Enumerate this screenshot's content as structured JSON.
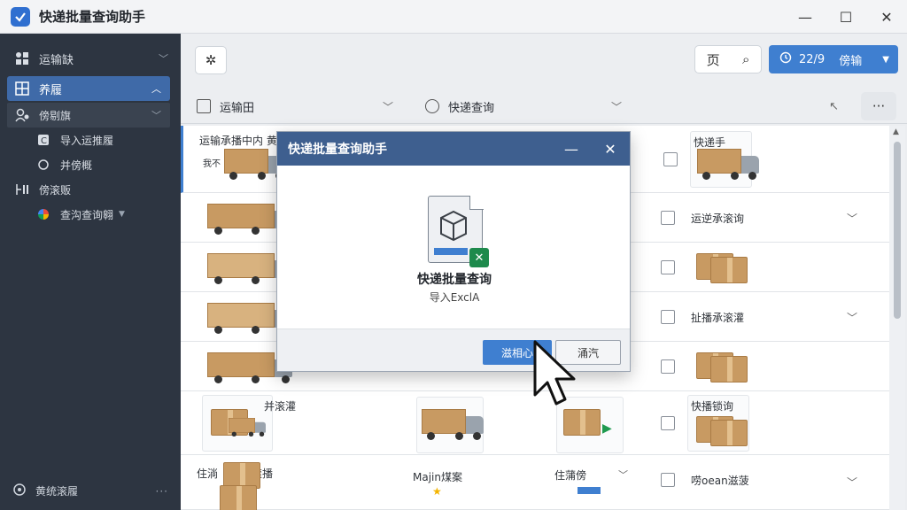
{
  "window": {
    "title": "快递批量查询助手",
    "minimize": "—",
    "maximize": "☐",
    "close": "✕"
  },
  "sidebar": {
    "items": [
      {
        "label": "运输缺",
        "icon": "grid-icon"
      },
      {
        "label": "养履",
        "icon": "list-icon"
      },
      {
        "label": "傍剔旗",
        "icon": "user-icon"
      },
      {
        "label": "导入运推履",
        "icon": "import-icon"
      },
      {
        "label": "并傍概",
        "icon": "circle-icon"
      },
      {
        "label": "傍滚贩",
        "icon": "columns-icon"
      },
      {
        "label": "查沟查询翱",
        "icon": "chart-icon"
      }
    ],
    "bottom_label": "黄统滚履",
    "bottom_more": "···"
  },
  "toolbar": {
    "tool_icon": "✲",
    "page_label": "页",
    "search_glyph": "⌕",
    "primary_label": "22/9",
    "primary_text": "傍输",
    "more_dots": "···",
    "back_glyph": "↖"
  },
  "filters": [
    {
      "label": "运输田"
    },
    {
      "label": "快递查询"
    }
  ],
  "rows": [
    {
      "text_a": "运输承播中内 黄",
      "text_a2": "我不",
      "text_c": "快递手",
      "has_chev": false
    },
    {
      "text_a": "",
      "text_c": "运逆承滚询",
      "has_chev": true
    },
    {
      "text_a": "",
      "text_c": "",
      "has_chev": false
    },
    {
      "text_a": "",
      "text_c": "扯播承滚灌",
      "has_chev": true
    },
    {
      "text_a": "",
      "text_c": "",
      "has_chev": false
    },
    {
      "text_a": "并滚灌",
      "text_c": "快播锁询",
      "has_chev": false
    },
    {
      "text_a": "住淌",
      "text_a2": "滚播",
      "text_b": "Majin煤案",
      "text_b2": "住蒲傍",
      "text_c": "唠oean滋菠",
      "has_chev": true
    }
  ],
  "dialog": {
    "title": "快递批量查询助手",
    "minimize": "—",
    "close": "✕",
    "file_badge": "✕",
    "heading": "快递批量查询",
    "subtext": "导入ExclA",
    "ok_label": "滋相心",
    "cancel_label": "涌汽"
  }
}
